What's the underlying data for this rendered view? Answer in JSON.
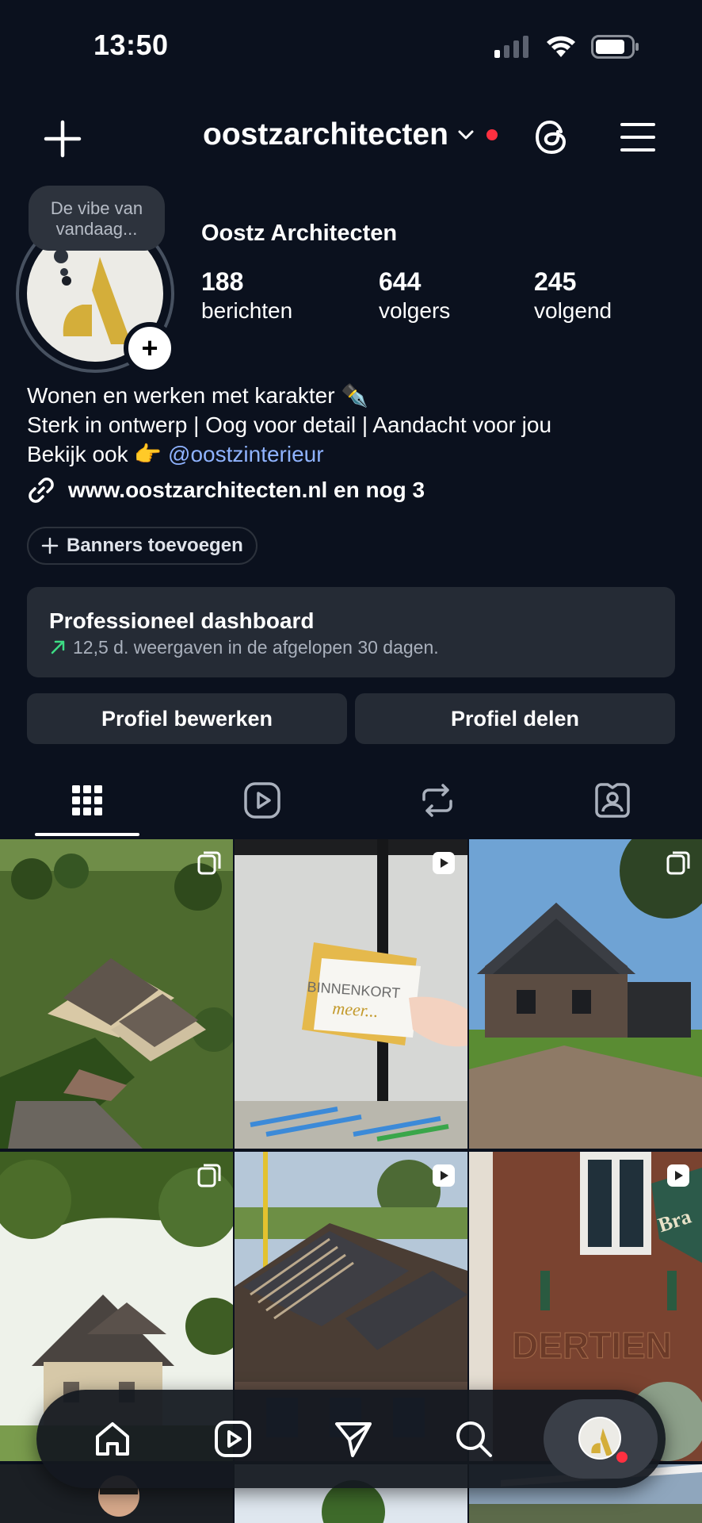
{
  "status_bar": {
    "time": "13:50"
  },
  "header": {
    "username": "oostzarchitecten"
  },
  "profile": {
    "note": "De vibe van vandaag...",
    "name": "Oostz Architecten",
    "stats": [
      {
        "value": "188",
        "label": "berichten"
      },
      {
        "value": "644",
        "label": "volgers"
      },
      {
        "value": "245",
        "label": "volgend"
      }
    ],
    "bio_line1": "Wonen en werken met karakter ✒️",
    "bio_line2": "Sterk in ontwerp | Oog voor detail | Aandacht voor jou",
    "bio_line3_prefix": "Bekijk ook 👉",
    "bio_mention": "@oostzinterieur",
    "link": "www.oostzarchitecten.nl en nog 3"
  },
  "banners_chip": "Banners toevoegen",
  "dashboard": {
    "title": "Professioneel dashboard",
    "subtitle": "12,5 d. weergaven in de afgelopen 30 dagen."
  },
  "buttons": {
    "edit": "Profiel bewerken",
    "share": "Profiel delen"
  },
  "tabs": [
    "grid-icon",
    "reels-icon",
    "reposts-icon",
    "tagged-icon"
  ],
  "grid": {
    "posts": [
      {
        "badge": "carousel-icon",
        "scene": "aerial villa render"
      },
      {
        "badge": "reel-icon",
        "card_text_1": "BINNENKORT",
        "card_text_2": "meer..."
      },
      {
        "badge": "carousel-icon",
        "scene": "brick house"
      },
      {
        "badge": "carousel-icon",
        "scene": "farmhouse render"
      },
      {
        "badge": "reel-icon",
        "scene": "construction site"
      },
      {
        "badge": "reel-icon",
        "sign_text": "DERTIEN",
        "sign_text_2": "Bra"
      }
    ]
  },
  "bottom_nav": [
    "home-icon",
    "reels-icon",
    "send-icon",
    "search-icon",
    "profile-avatar"
  ],
  "colors": {
    "background": "#0b111e",
    "surface": "#252b35",
    "accent_red": "#ff3040",
    "mention": "#8fb3ff",
    "logo_gold": "#d4ae3a"
  }
}
